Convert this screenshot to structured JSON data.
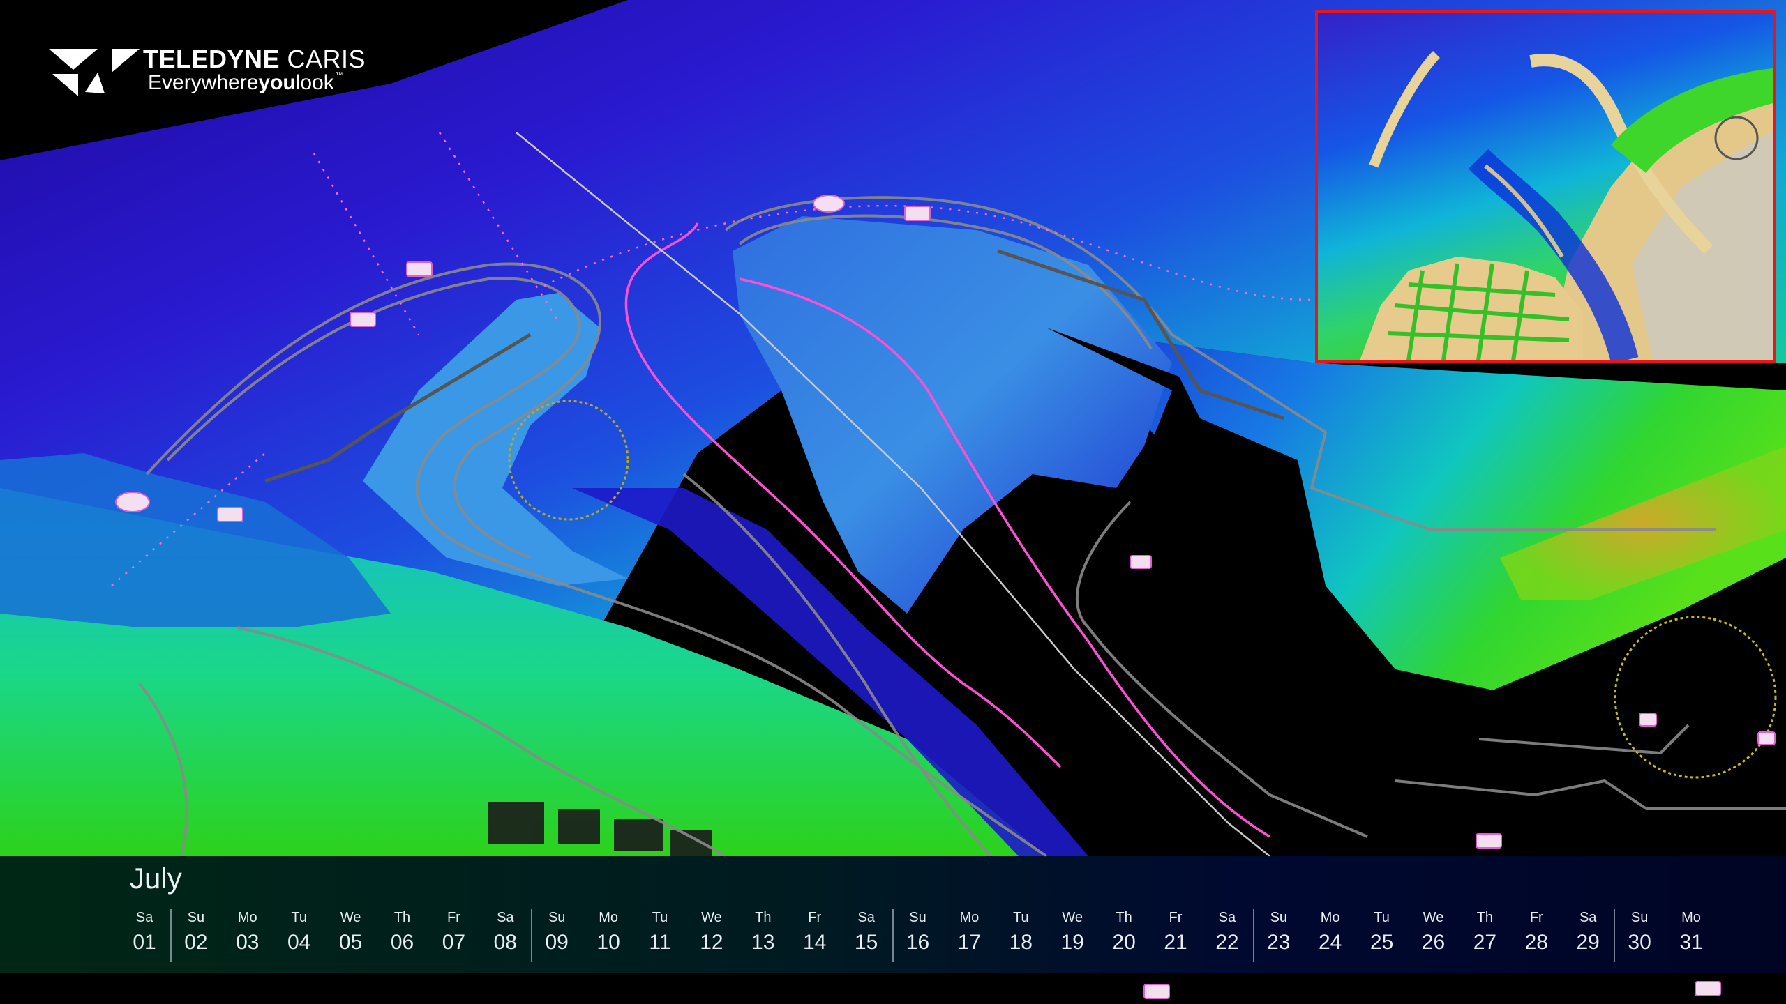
{
  "brand": {
    "name_bold": "TELEDYNE",
    "name_light": "CARIS",
    "tag_plain_1": "Everywhere",
    "tag_bold": "you",
    "tag_plain_2": "look",
    "trademark": "™"
  },
  "calendar": {
    "month": "July",
    "days": [
      {
        "dow": "Sa",
        "num": "01"
      },
      {
        "dow": "Su",
        "num": "02"
      },
      {
        "dow": "Mo",
        "num": "03"
      },
      {
        "dow": "Tu",
        "num": "04"
      },
      {
        "dow": "We",
        "num": "05"
      },
      {
        "dow": "Th",
        "num": "06"
      },
      {
        "dow": "Fr",
        "num": "07"
      },
      {
        "dow": "Sa",
        "num": "08"
      },
      {
        "dow": "Su",
        "num": "09"
      },
      {
        "dow": "Mo",
        "num": "10"
      },
      {
        "dow": "Tu",
        "num": "11"
      },
      {
        "dow": "We",
        "num": "12"
      },
      {
        "dow": "Th",
        "num": "13"
      },
      {
        "dow": "Fr",
        "num": "14"
      },
      {
        "dow": "Sa",
        "num": "15"
      },
      {
        "dow": "Su",
        "num": "16"
      },
      {
        "dow": "Mo",
        "num": "17"
      },
      {
        "dow": "Tu",
        "num": "18"
      },
      {
        "dow": "We",
        "num": "19"
      },
      {
        "dow": "Th",
        "num": "20"
      },
      {
        "dow": "Fr",
        "num": "21"
      },
      {
        "dow": "Sa",
        "num": "22"
      },
      {
        "dow": "Su",
        "num": "23"
      },
      {
        "dow": "Mo",
        "num": "24"
      },
      {
        "dow": "Tu",
        "num": "25"
      },
      {
        "dow": "We",
        "num": "26"
      },
      {
        "dow": "Th",
        "num": "27"
      },
      {
        "dow": "Fr",
        "num": "28"
      },
      {
        "dow": "Sa",
        "num": "29"
      },
      {
        "dow": "Su",
        "num": "30"
      },
      {
        "dow": "Mo",
        "num": "31"
      }
    ]
  },
  "colors": {
    "deep_water": "#1a13b4",
    "mid_water": "#1e6fe0",
    "shallow_water": "#16c9a8",
    "shoal": "#34d816",
    "high": "#d9a02a",
    "land": "#e6c98a",
    "route_line": "#ff55d8",
    "inset_border": "#e8161b"
  }
}
